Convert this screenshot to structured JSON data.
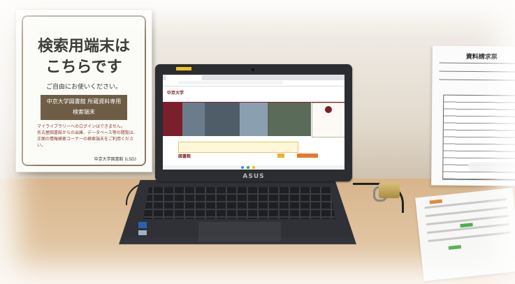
{
  "sign": {
    "title_line1": "検索用端末は",
    "title_line2": "こちらです",
    "subtitle": "ご自由にお使いください。",
    "band_line1": "中京大学図書館 所蔵資料専用",
    "band_line2": "検索端末",
    "note1": "マイライブラリーへのログインはできません。",
    "note2": "名古屋図書館からの出庫、データベース等の閲覧は、正面の情報検索コーナーの検索端末をご利用ください。",
    "footer": "中京大学図書館 (LSD)"
  },
  "right_doc": {
    "title": "資料請求票"
  },
  "laptop": {
    "brand": "ASUS",
    "site_logo": "中京大学",
    "library_heading": "図書館"
  }
}
